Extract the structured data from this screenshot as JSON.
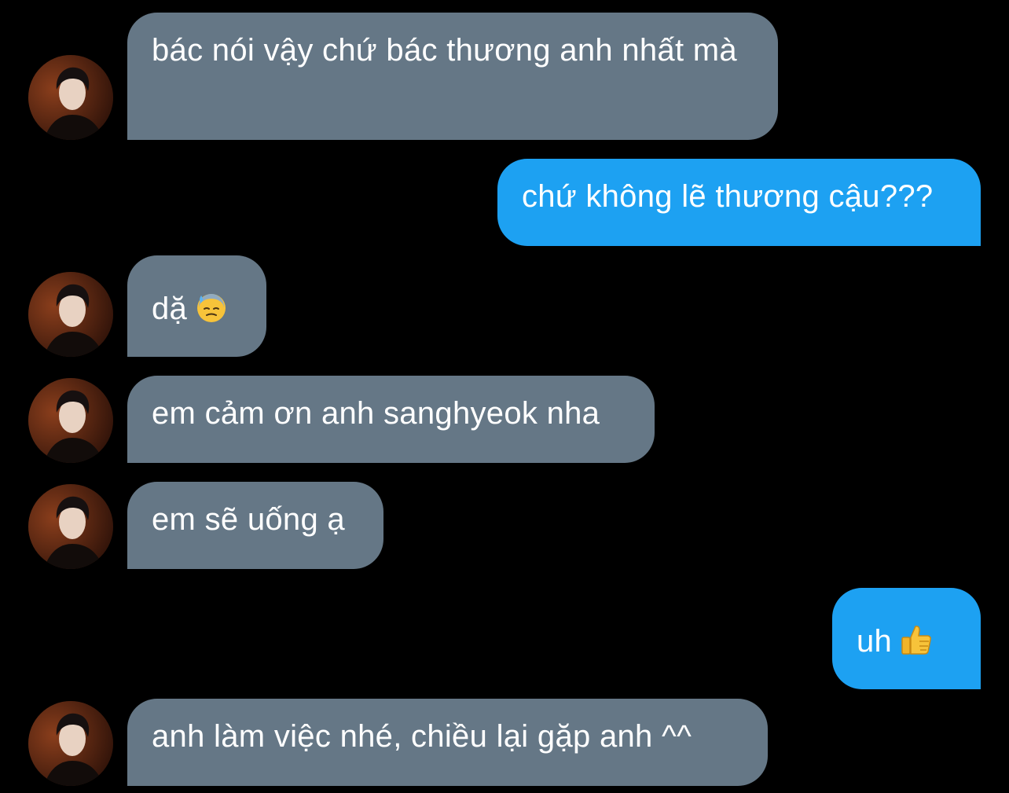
{
  "conversation": {
    "messages": [
      {
        "direction": "received",
        "text": "bác nói vậy chứ bác thương anh nhất mà",
        "has_avatar": true
      },
      {
        "direction": "sent",
        "text": "chứ không lẽ thương cậu???"
      },
      {
        "direction": "received",
        "text": "dặ",
        "emoji": "downcast-face-with-sweat-icon",
        "has_avatar": true
      },
      {
        "direction": "received",
        "text": "em cảm ơn anh sanghyeok nha",
        "has_avatar": true
      },
      {
        "direction": "received",
        "text": "em sẽ uống ạ",
        "has_avatar": true
      },
      {
        "direction": "sent",
        "text": "uh",
        "emoji": "thumbs-up-icon"
      },
      {
        "direction": "received",
        "text": "anh làm việc nhé, chiều lại gặp anh ^^",
        "has_avatar": true
      }
    ]
  },
  "colors": {
    "background": "#000000",
    "received_bubble": "#657786",
    "sent_bubble": "#1da1f2",
    "text": "#ffffff"
  }
}
